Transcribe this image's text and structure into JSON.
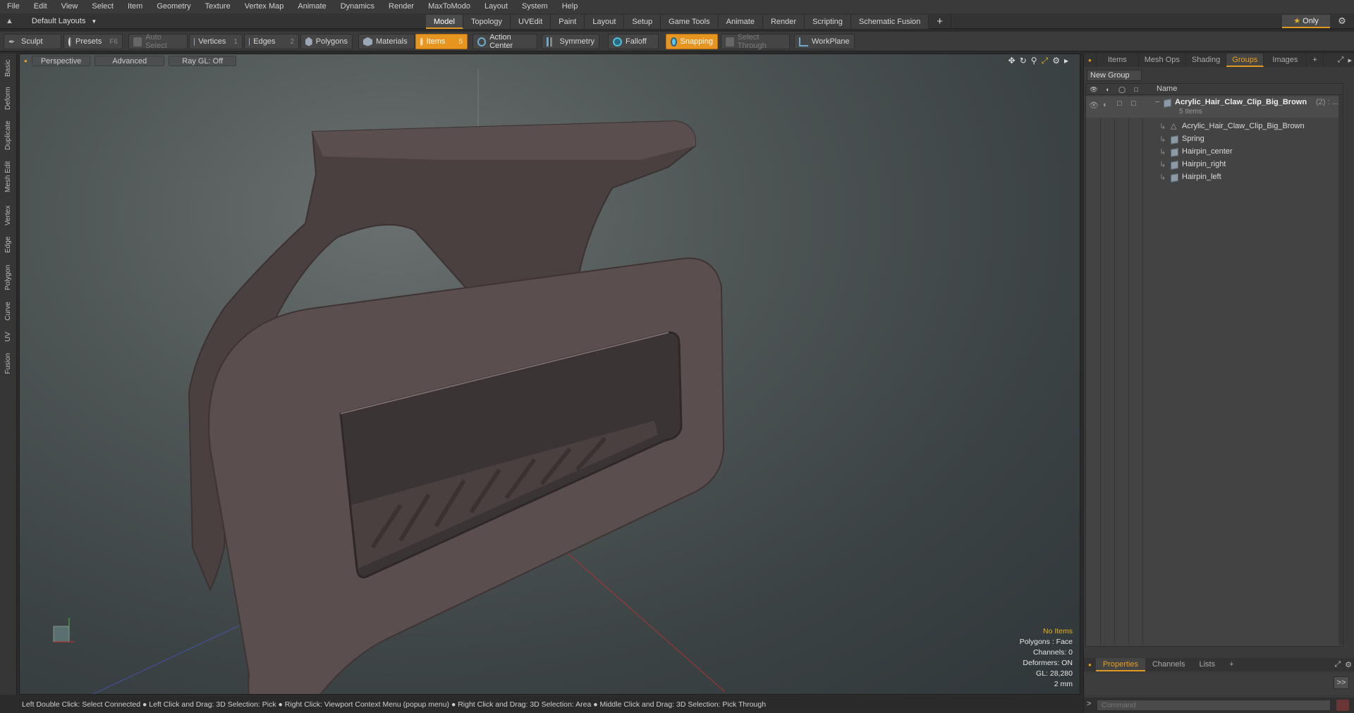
{
  "menu": [
    "File",
    "Edit",
    "View",
    "Select",
    "Item",
    "Geometry",
    "Texture",
    "Vertex Map",
    "Animate",
    "Dynamics",
    "Render",
    "MaxToModo",
    "Layout",
    "System",
    "Help"
  ],
  "layout_selector": "Default Layouts",
  "tabs": [
    "Model",
    "Topology",
    "UVEdit",
    "Paint",
    "Layout",
    "Setup",
    "Game Tools",
    "Animate",
    "Render",
    "Scripting",
    "Schematic Fusion"
  ],
  "active_tab": "Model",
  "only_label": "Only",
  "toolbar": {
    "sculpt": "Sculpt",
    "presets": "Presets",
    "presets_key": "F6",
    "auto_select": "Auto Select",
    "vertices": "Vertices",
    "vertices_key": "1",
    "edges": "Edges",
    "edges_key": "2",
    "polygons": "Polygons",
    "materials": "Materials",
    "items": "Items",
    "items_key": "5",
    "action_center": "Action Center",
    "symmetry": "Symmetry",
    "falloff": "Falloff",
    "snapping": "Snapping",
    "select_through": "Select Through",
    "workplane": "WorkPlane"
  },
  "left_tabs": [
    "Basic",
    "Deform",
    "Duplicate",
    "Mesh Edit",
    "Vertex",
    "Edge",
    "Polygon",
    "Curve",
    "UV",
    "Fusion"
  ],
  "viewport": {
    "view_mode": "Perspective",
    "shading": "Advanced",
    "raygl": "Ray GL: Off",
    "info": {
      "no_items": "No Items",
      "polygons": "Polygons : Face",
      "channels": "Channels: 0",
      "deformers": "Deformers: ON",
      "gl": "GL: 28,280",
      "unit": "2 mm"
    }
  },
  "status_bar": "Left Double Click: Select Connected ● Left Click and Drag: 3D Selection: Pick ● Right Click: Viewport Context Menu (popup menu) ● Right Click and Drag: 3D Selection: Area ● Middle Click and Drag: 3D Selection: Pick Through",
  "right_panel": {
    "tabs": [
      "Items",
      "Mesh Ops",
      "Shading",
      "Groups",
      "Images"
    ],
    "active_tab": "Groups",
    "new_group": "New Group",
    "column_name": "Name",
    "group": {
      "name": "Acrylic_Hair_Claw_Clip_Big_Brown",
      "count_suffix": "(2) : ...",
      "items_count": "5 Items",
      "children": [
        "Acrylic_Hair_Claw_Clip_Big_Brown",
        "Spring",
        "Hairpin_center",
        "Hairpin_right",
        "Hairpin_left"
      ]
    },
    "bottom_tabs": [
      "Properties",
      "Channels",
      "Lists"
    ],
    "active_bottom_tab": "Properties",
    "command_placeholder": "Command"
  },
  "colors": {
    "accent": "#e69520",
    "model": "#554a4a",
    "viewport_bg": "#4f5656"
  }
}
